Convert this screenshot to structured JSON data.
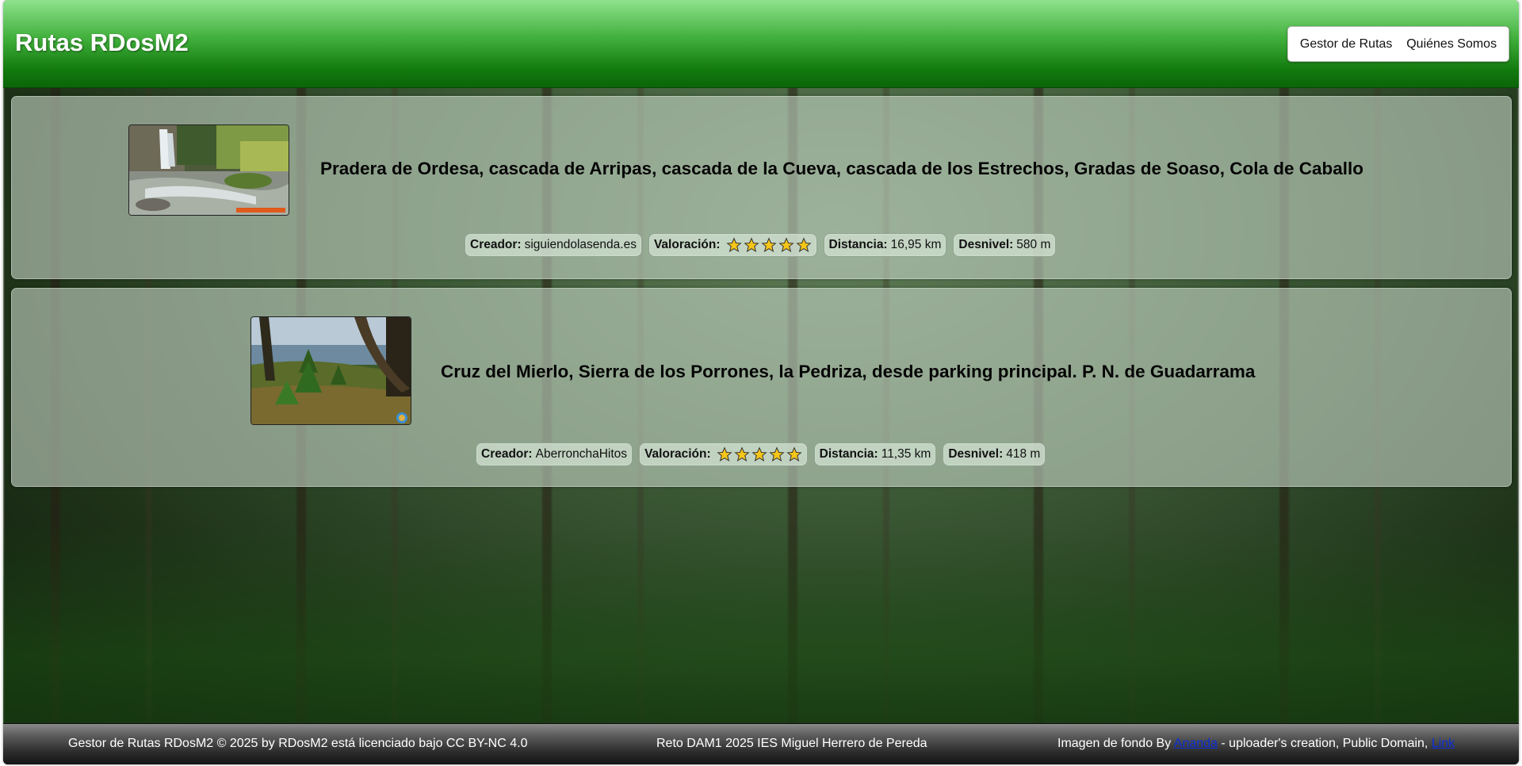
{
  "header": {
    "title": "Rutas RDosM2",
    "nav": [
      {
        "label": "Gestor de Rutas"
      },
      {
        "label": "Quiénes Somos"
      }
    ]
  },
  "routes": [
    {
      "title": "Pradera de Ordesa, cascada de Arripas, cascada de la Cueva, cascada de los Estrechos, Gradas de Soaso, Cola de Caballo",
      "creator_label": "Creador:",
      "creator": "siguiendolasenda.es",
      "rating_label": "Valoración:",
      "rating": 5,
      "distance_label": "Distancia:",
      "distance": "16,95 km",
      "elevation_label": "Desnivel:",
      "elevation": "580 m",
      "thumb_icon": "waterfall-photo"
    },
    {
      "title": "Cruz del Mierlo, Sierra de los Porrones, la Pedriza, desde parking principal. P. N. de Guadarrama",
      "creator_label": "Creador:",
      "creator": "AberronchaHitos",
      "rating_label": "Valoración:",
      "rating": 5,
      "distance_label": "Distancia:",
      "distance": "11,35 km",
      "elevation_label": "Desnivel:",
      "elevation": "418 m",
      "thumb_icon": "pine-forest-photo"
    }
  ],
  "footer": {
    "license": "Gestor de Rutas RDosM2 © 2025 by RDosM2 está licenciado bajo CC BY-NC 4.0",
    "credit": "Reto DAM1 2025 IES Miguel Herrero de Pereda",
    "image_prefix": "Imagen de fondo By ",
    "image_author": "Ananda",
    "image_middle": " - uploader's creation, Public Domain, ",
    "image_link": "Link"
  },
  "colors": {
    "header_top": "#8ee28c",
    "header_bottom": "#0b6508",
    "star_fill": "#f5c518",
    "footer_link": "#0b2fd6"
  }
}
